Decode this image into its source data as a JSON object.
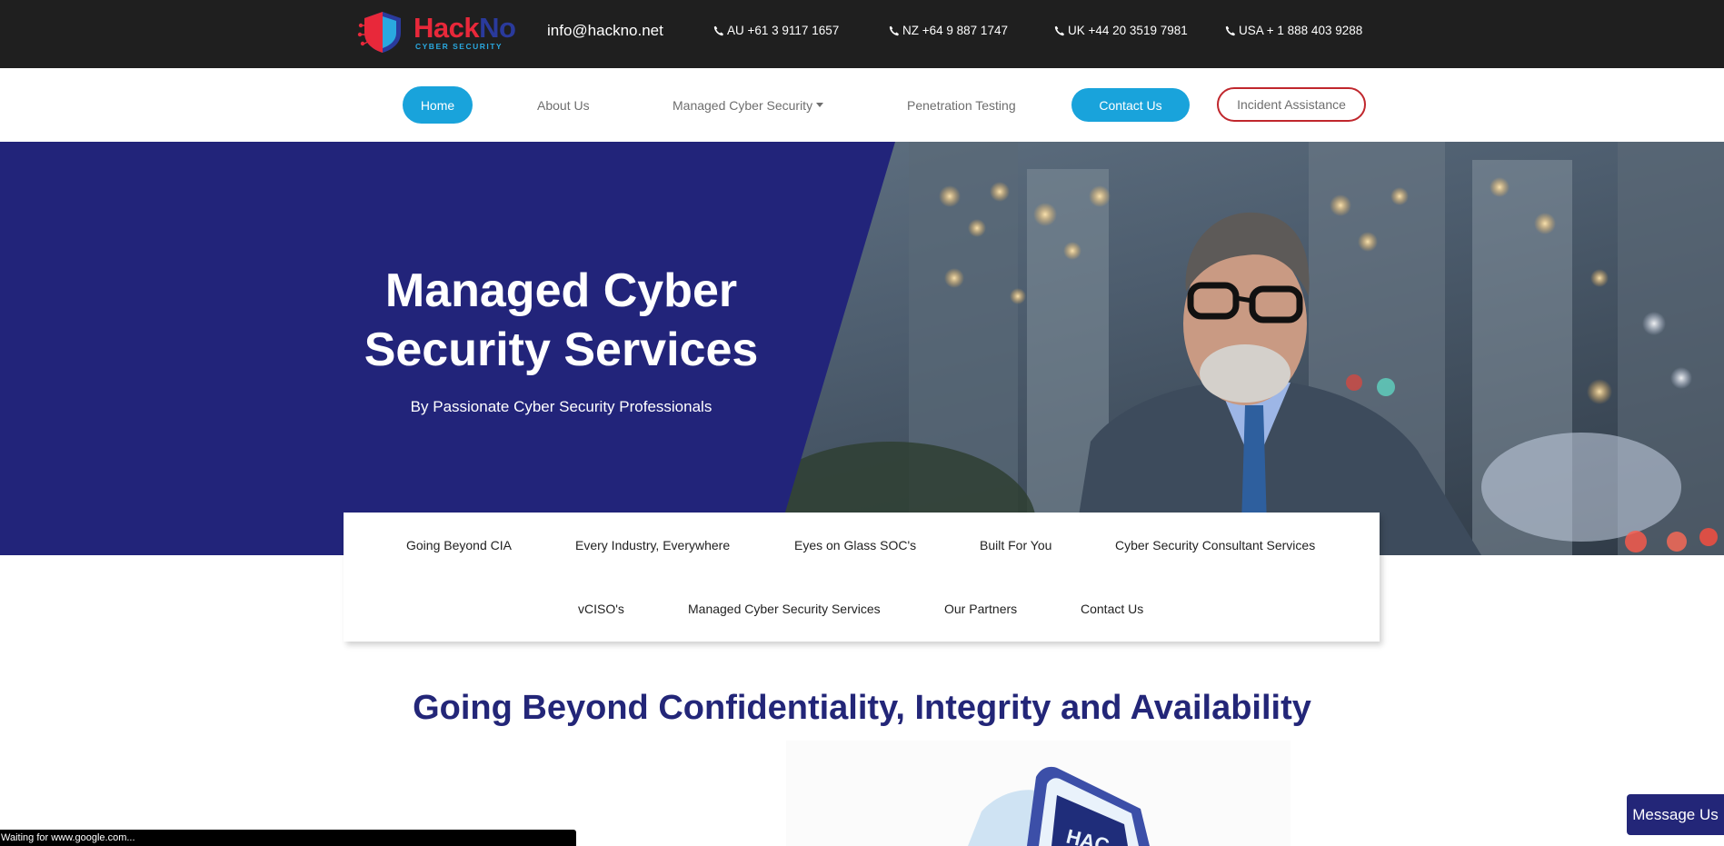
{
  "header": {
    "logo": {
      "brand_hack": "Hack",
      "brand_no": "No",
      "tagline": "CYBER SECURITY"
    },
    "email": "info@hackno.net",
    "phones": [
      {
        "label": "AU +61 3 9117 1657"
      },
      {
        "label": "NZ +64 9 887 1747"
      },
      {
        "label": "UK +44 20 3519 7981"
      },
      {
        "label": "USA + 1 888 403 9288"
      }
    ]
  },
  "nav": {
    "home": "Home",
    "about": "About Us",
    "managed": "Managed Cyber Security",
    "pentest": "Penetration Testing",
    "contact": "Contact Us",
    "incident": "Incident Assistance"
  },
  "hero": {
    "title_line1": "Managed Cyber",
    "title_line2": "Security Services",
    "subtitle": "By Passionate Cyber Security Professionals"
  },
  "tabs": {
    "row1": [
      "Going Beyond CIA",
      "Every Industry, Everywhere",
      "Eyes on Glass SOC's",
      "Built For You",
      "Cyber Security Consultant Services"
    ],
    "row2": [
      "vCISO's",
      "Managed Cyber Security Services",
      "Our Partners",
      "Contact Us"
    ]
  },
  "section": {
    "title": "Going Beyond Confidentiality, Integrity and Availability"
  },
  "message_button": "Message Us",
  "status_text": "Waiting for www.google.com...",
  "colors": {
    "topbar": "#1f1f1f",
    "accent_blue": "#19a3db",
    "hero_navy": "#22247a",
    "incident_red": "#c0272d",
    "heading_navy": "#232678"
  }
}
